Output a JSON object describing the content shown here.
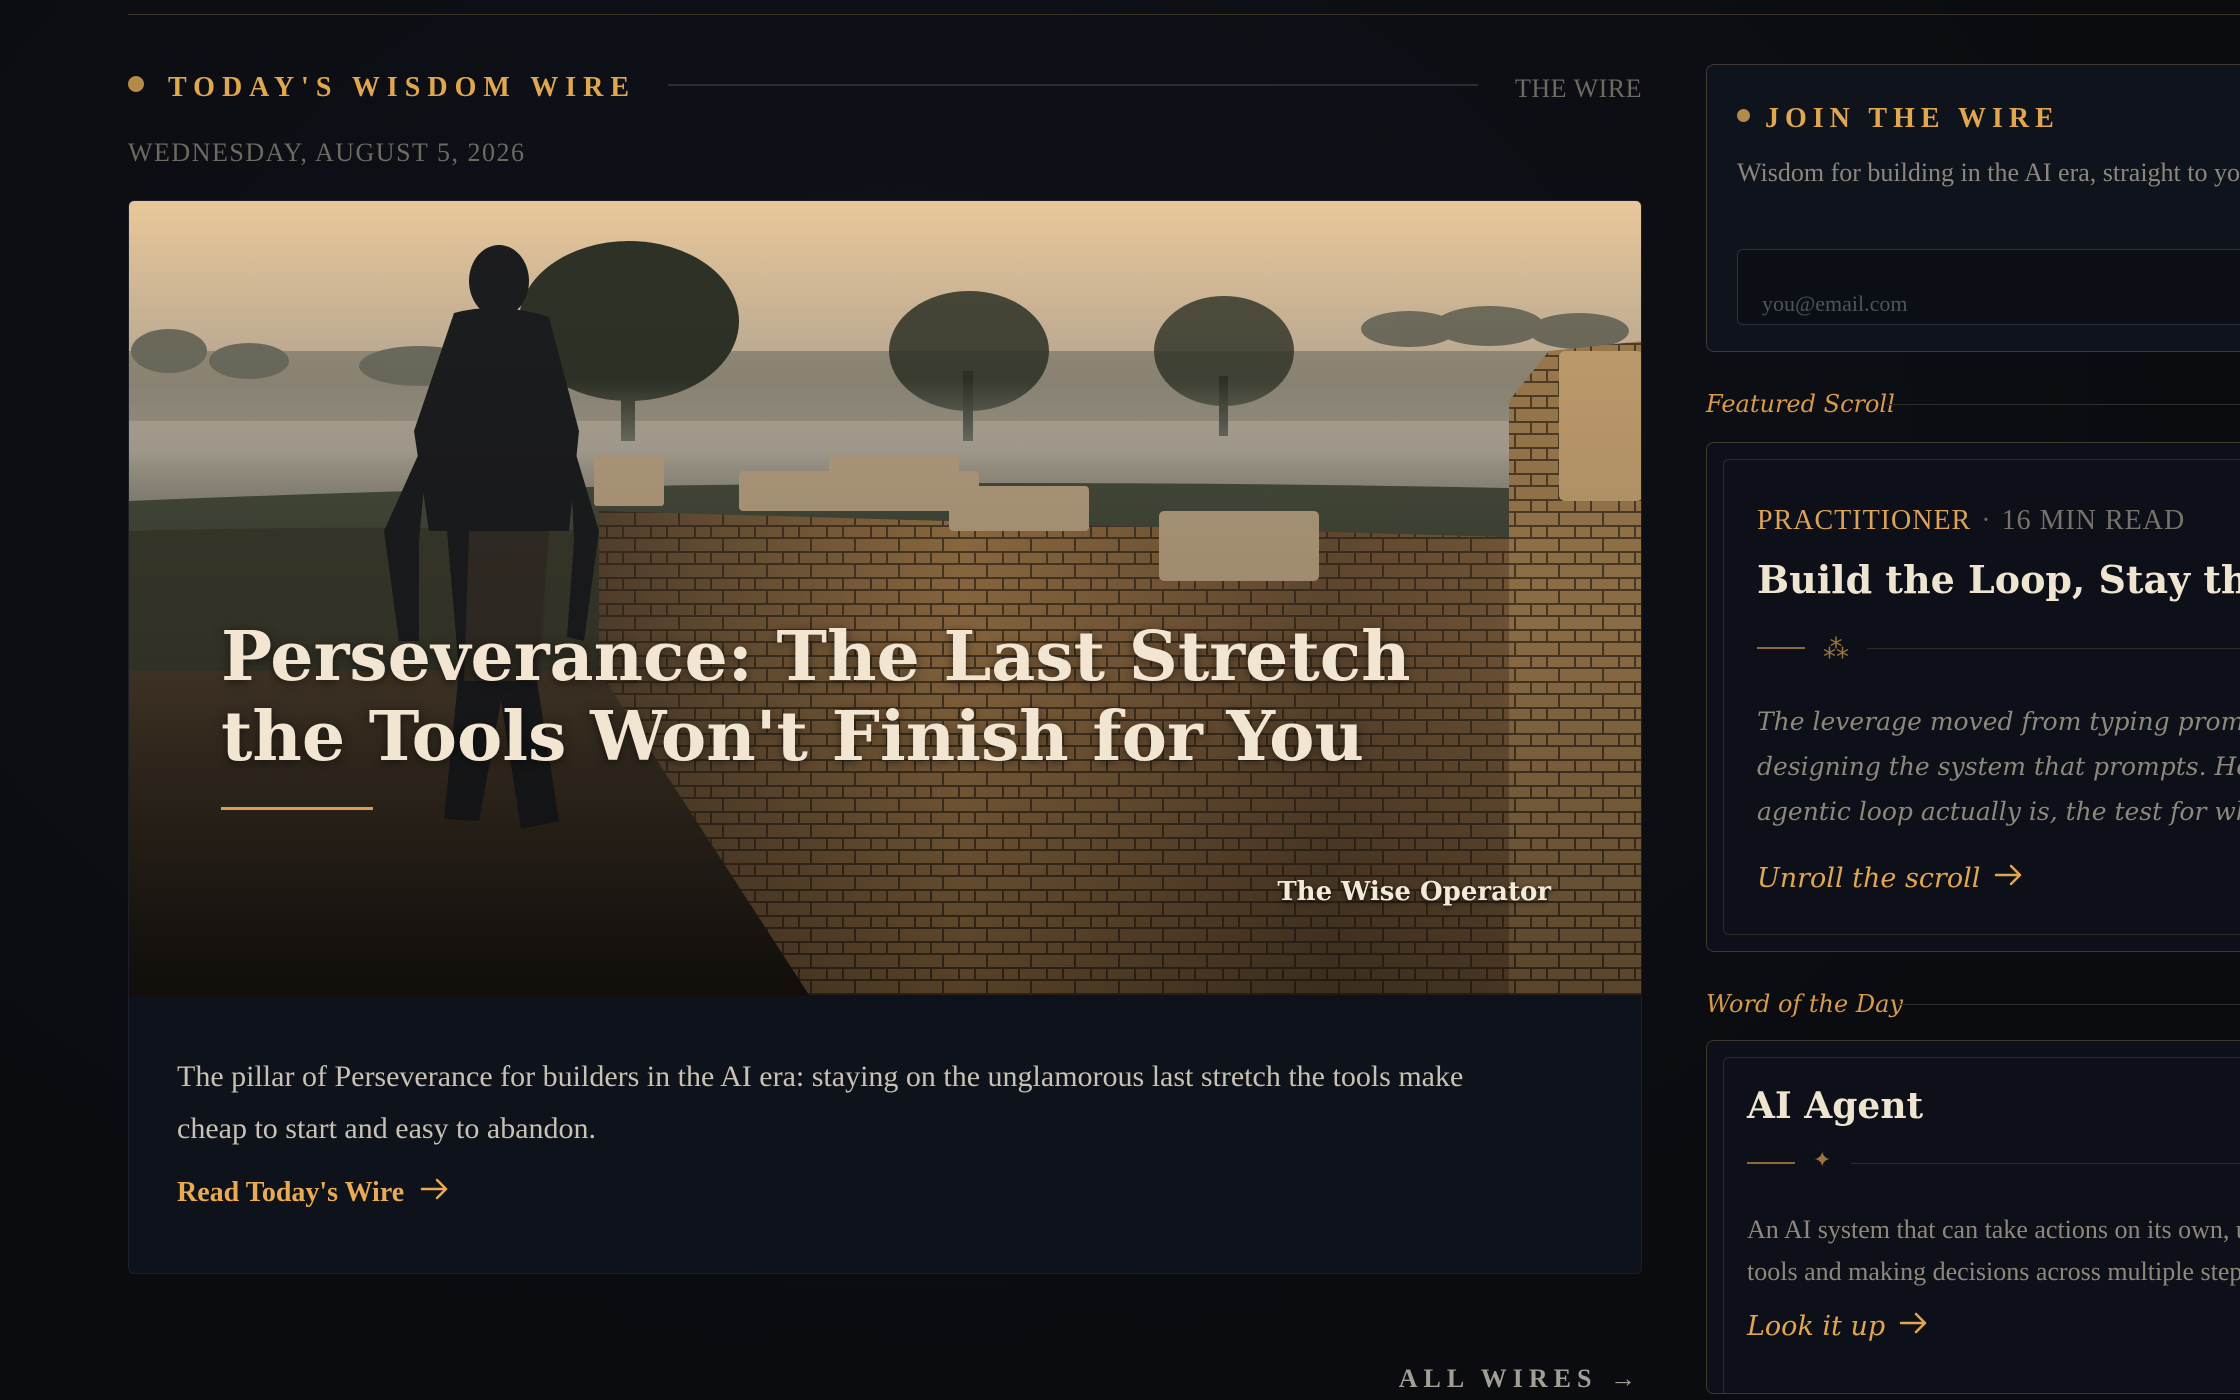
{
  "wire": {
    "title": "TODAY'S WISDOM WIRE",
    "link": "THE WIRE",
    "date": "WEDNESDAY, AUGUST 5, 2026"
  },
  "hero": {
    "title": "Perseverance: The Last Stretch the Tools Won't Finish for You",
    "brand": "The Wise Operator",
    "description": "The pillar of Perseverance for builders in the AI era: staying on the unglamorous last stretch the tools make cheap to start and easy to abandon.",
    "read_label": "Read Today's Wire"
  },
  "all_wires_label": "ALL WIRES →",
  "join": {
    "title": "JOIN THE WIRE",
    "description": "Wisdom for building in the AI era, straight to your inbox.",
    "email_placeholder": "you@email.com"
  },
  "featured": {
    "section_label": "Featured Scroll",
    "category": "PRACTITIONER",
    "separator": "·",
    "read_time": "16 MIN READ",
    "title": "Build the Loop, Stay the Engineer",
    "ornament": "⁂",
    "excerpt": [
      "The leverage moved from typing prompts to",
      "designing the system that prompts. Here is what an",
      "agentic loop actually is, the test for whether you need one"
    ],
    "link_label": "Unroll the scroll"
  },
  "word": {
    "section_label": "Word of the Day",
    "term": "AI Agent",
    "ornament": "✦",
    "definition": [
      "An AI system that can take actions on its own, using",
      "tools and making decisions across multiple steps."
    ],
    "link_label": "Look it up"
  },
  "colors": {
    "accent_gold": "#e0a74f",
    "background": "#0b0d12",
    "card_border": "#3f3a2e"
  }
}
